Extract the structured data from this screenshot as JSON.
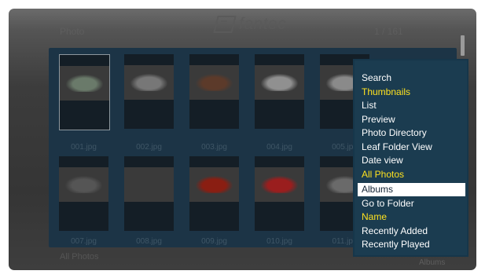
{
  "header": {
    "left": "Photo",
    "right": "1 / 161"
  },
  "brand": {
    "name": "fantec"
  },
  "grid": {
    "tiles": [
      {
        "label": "001.jpg",
        "selected": true,
        "color": "#6a7a6a"
      },
      {
        "label": "002.jpg",
        "selected": false,
        "color": "#777777"
      },
      {
        "label": "003.jpg",
        "selected": false,
        "color": "#5c3a2a"
      },
      {
        "label": "004.jpg",
        "selected": false,
        "color": "#909090"
      },
      {
        "label": "005.jpg",
        "selected": false,
        "color": "#8a8a8a"
      },
      {
        "label": "007.jpg",
        "selected": false,
        "color": "#555555"
      },
      {
        "label": "008.jpg",
        "selected": false,
        "color": "#3a3a3a"
      },
      {
        "label": "009.jpg",
        "selected": false,
        "color": "#8a1e12"
      },
      {
        "label": "010.jpg",
        "selected": false,
        "color": "#9a1e1e"
      },
      {
        "label": "011.jpg",
        "selected": false,
        "color": "#6a6a6a"
      }
    ]
  },
  "footer": {
    "left": "All Photos",
    "right": "Albums"
  },
  "menu": {
    "items": [
      {
        "label": "Search",
        "style": "normal"
      },
      {
        "label": "Thumbnails",
        "style": "yellow"
      },
      {
        "label": "List",
        "style": "normal"
      },
      {
        "label": "Preview",
        "style": "normal"
      },
      {
        "label": "Photo Directory",
        "style": "normal"
      },
      {
        "label": "Leaf Folder View",
        "style": "normal"
      },
      {
        "label": "Date view",
        "style": "normal"
      },
      {
        "label": "All Photos",
        "style": "yellow"
      },
      {
        "label": "Albums",
        "style": "selected"
      },
      {
        "label": "Go to Folder",
        "style": "normal"
      },
      {
        "label": "Name",
        "style": "yellow"
      },
      {
        "label": "Recently Added",
        "style": "normal"
      },
      {
        "label": "Recently Played",
        "style": "normal"
      }
    ]
  }
}
